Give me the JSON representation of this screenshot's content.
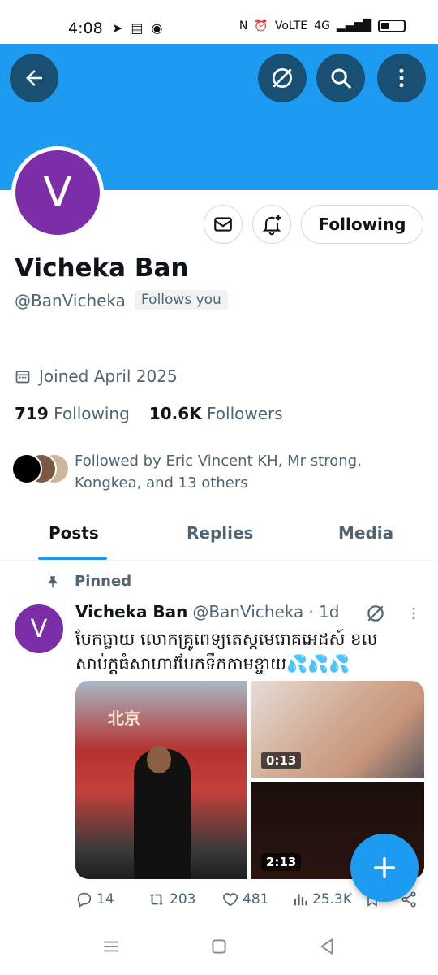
{
  "status_bar": {
    "time": "4:08",
    "network": "4G",
    "carrier_tag": "VoLTE"
  },
  "profile": {
    "avatar_letter": "V",
    "display_name": "Vicheka Ban",
    "handle": "@BanVicheka",
    "follows_you": "Follows you",
    "follow_button": "Following",
    "joined": "Joined April 2025",
    "following_count": "719",
    "following_label": "Following",
    "followers_count": "10.6K",
    "followers_label": "Followers",
    "followed_by": "Followed by Eric Vincent KH, Mr strong, Kongkea, and 13 others"
  },
  "tabs": [
    {
      "label": "Posts",
      "active": true
    },
    {
      "label": "Replies",
      "active": false
    },
    {
      "label": "Media",
      "active": false
    }
  ],
  "post": {
    "pinned_label": "Pinned",
    "avatar_letter": "V",
    "name": "Vicheka Ban",
    "handle": "@BanVicheka",
    "time": "· 1d",
    "text": "បែកធ្លាយ លោកគ្រូពេទ្យតេស្តមេរោគអេដស៍ ខលសាប់ក្ដធំសាហាវបែកទឹកកាមខ្ចាយ",
    "text_emoji": "💦💦💦",
    "media": [
      {
        "kind": "photo",
        "sign": "北京"
      },
      {
        "kind": "video",
        "duration": "0:13"
      },
      {
        "kind": "video",
        "duration": "2:13"
      }
    ],
    "replies": "14",
    "reposts": "203",
    "likes": "481",
    "views": "25.3K"
  },
  "colors": {
    "brand": "#1d9bf0",
    "dark_button": "#184f73",
    "avatar_purple": "#7b2ea8",
    "muted_text": "#536471"
  },
  "icons": [
    "back-arrow-icon",
    "grok-icon",
    "search-icon",
    "more-vertical-icon",
    "mail-icon",
    "bell-plus-icon",
    "calendar-icon",
    "pin-icon",
    "reply-icon",
    "repost-icon",
    "heart-icon",
    "views-icon",
    "bookmark-icon",
    "share-icon",
    "plus-icon",
    "menu-icon",
    "home-square-icon",
    "back-triangle-icon"
  ]
}
